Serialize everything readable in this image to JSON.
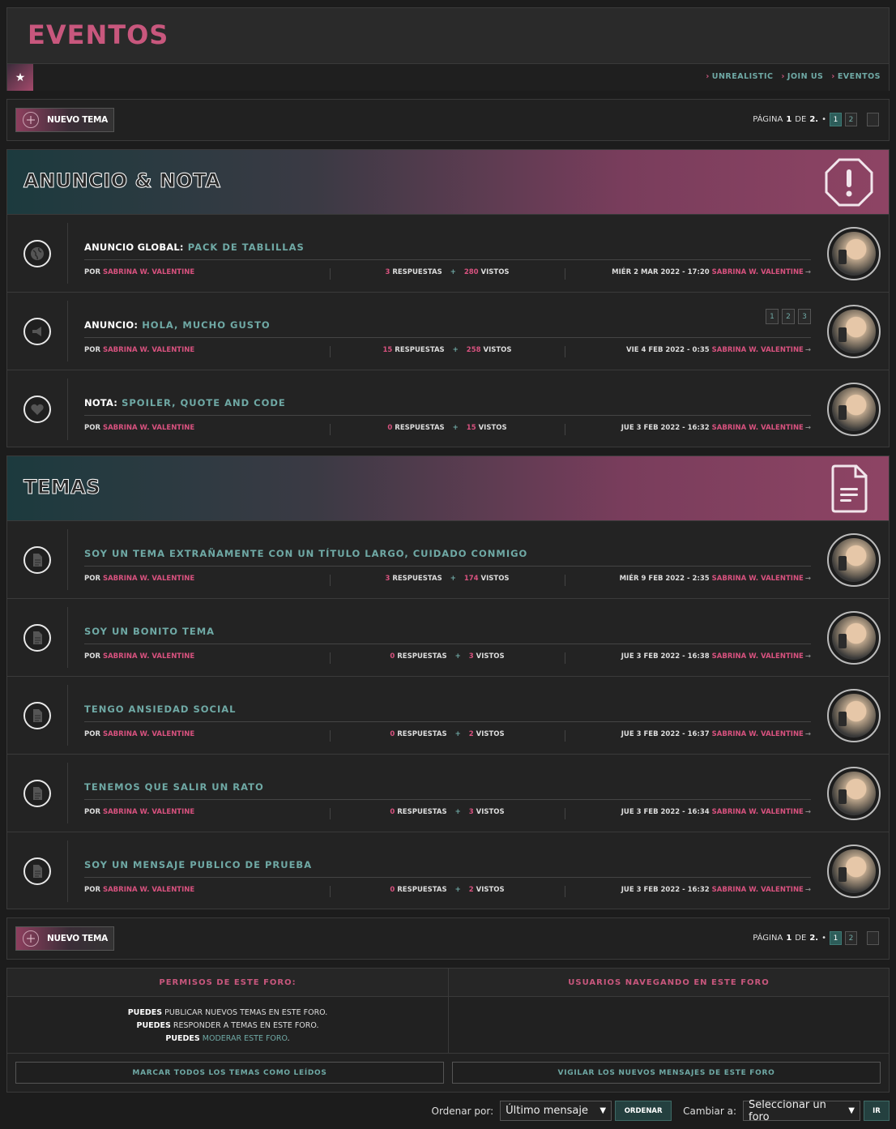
{
  "header": {
    "title": "EVENTOS",
    "breadcrumbs": [
      "UNREALISTIC",
      "JOIN US",
      "EVENTOS"
    ]
  },
  "actions": {
    "new_topic": "NUEVO TEMA",
    "page_label": "PÁGINA",
    "page_current": "1",
    "page_of": "DE",
    "page_total": "2.",
    "page_bullet": "•",
    "pages": [
      "1",
      "2"
    ]
  },
  "announcements": {
    "title": "ANUNCIO & NOTA",
    "rows": [
      {
        "label": "ANUNCIO GLOBAL:",
        "title": "PACK DE TABLILLAS",
        "icon": "globe-icon",
        "by": "POR",
        "author": "SABRINA W. VALENTINE",
        "replies": "3",
        "replies_label": "RESPUESTAS",
        "views": "280",
        "views_label": "VISTOS",
        "date": "MIÉR 2 MAR 2022 - 17:20",
        "last_author": "SABRINA W. VALENTINE"
      },
      {
        "label": "ANUNCIO:",
        "title": "HOLA, MUCHO GUSTO",
        "icon": "megaphone-icon",
        "by": "POR",
        "author": "SABRINA W. VALENTINE",
        "replies": "15",
        "replies_label": "RESPUESTAS",
        "views": "258",
        "views_label": "VISTOS",
        "date": "VIE 4 FEB 2022 - 0:35",
        "last_author": "SABRINA W. VALENTINE",
        "pages": [
          "1",
          "2",
          "3"
        ]
      },
      {
        "label": "NOTA:",
        "title": "SPOILER, QUOTE AND CODE",
        "icon": "heart-icon",
        "by": "POR",
        "author": "SABRINA W. VALENTINE",
        "replies": "0",
        "replies_label": "RESPUESTAS",
        "views": "15",
        "views_label": "VISTOS",
        "date": "JUE 3 FEB 2022 - 16:32",
        "last_author": "SABRINA W. VALENTINE"
      }
    ]
  },
  "topics": {
    "title": "TEMAS",
    "rows": [
      {
        "title": "SOY UN TEMA EXTRAÑAMENTE CON UN TÍTULO LARGO, CUIDADO CONMIGO",
        "by": "POR",
        "author": "SABRINA W. VALENTINE",
        "replies": "3",
        "replies_label": "RESPUESTAS",
        "views": "174",
        "views_label": "VISTOS",
        "date": "MIÉR 9 FEB 2022 - 2:35",
        "last_author": "SABRINA W. VALENTINE"
      },
      {
        "title": "SOY UN BONITO TEMA",
        "by": "POR",
        "author": "SABRINA W. VALENTINE",
        "replies": "0",
        "replies_label": "RESPUESTAS",
        "views": "3",
        "views_label": "VISTOS",
        "date": "JUE 3 FEB 2022 - 16:38",
        "last_author": "SABRINA W. VALENTINE"
      },
      {
        "title": "TENGO ANSIEDAD SOCIAL",
        "by": "POR",
        "author": "SABRINA W. VALENTINE",
        "replies": "0",
        "replies_label": "RESPUESTAS",
        "views": "2",
        "views_label": "VISTOS",
        "date": "JUE 3 FEB 2022 - 16:37",
        "last_author": "SABRINA W. VALENTINE"
      },
      {
        "title": "TENEMOS QUE SALIR UN RATO",
        "by": "POR",
        "author": "SABRINA W. VALENTINE",
        "replies": "0",
        "replies_label": "RESPUESTAS",
        "views": "3",
        "views_label": "VISTOS",
        "date": "JUE 3 FEB 2022 - 16:34",
        "last_author": "SABRINA W. VALENTINE"
      },
      {
        "title": "SOY UN MENSAJE PUBLICO DE PRUEBA",
        "by": "POR",
        "author": "SABRINA W. VALENTINE",
        "replies": "0",
        "replies_label": "RESPUESTAS",
        "views": "2",
        "views_label": "VISTOS",
        "date": "JUE 3 FEB 2022 - 16:32",
        "last_author": "SABRINA W. VALENTINE"
      }
    ]
  },
  "info": {
    "permissions_title": "PERMISOS DE ESTE FORO:",
    "users_title": "USUARIOS NAVEGANDO EN ESTE FORO",
    "perm_word": "PUEDES",
    "perm1": "PUBLICAR NUEVOS TEMAS EN ESTE FORO.",
    "perm2": "RESPONDER A TEMAS EN ESTE FORO.",
    "perm3_link": "MODERAR ESTE FORO",
    "perm3_end": ".",
    "mark_read": "MARCAR TODOS LOS TEMAS COMO LEÍDOS",
    "watch": "VIGILAR LOS NUEVOS MENSAJES DE ESTE FORO"
  },
  "controls": {
    "order_label": "Ordenar por:",
    "order_value": "Último mensaje",
    "order_button": "ORDENAR",
    "jump_label": "Cambiar a:",
    "jump_value": "Seleccionar un foro",
    "jump_button": "IR"
  },
  "colors": {
    "accent_pink": "#d8527f",
    "accent_teal": "#6fa9a5",
    "background": "#1c1c1c"
  }
}
